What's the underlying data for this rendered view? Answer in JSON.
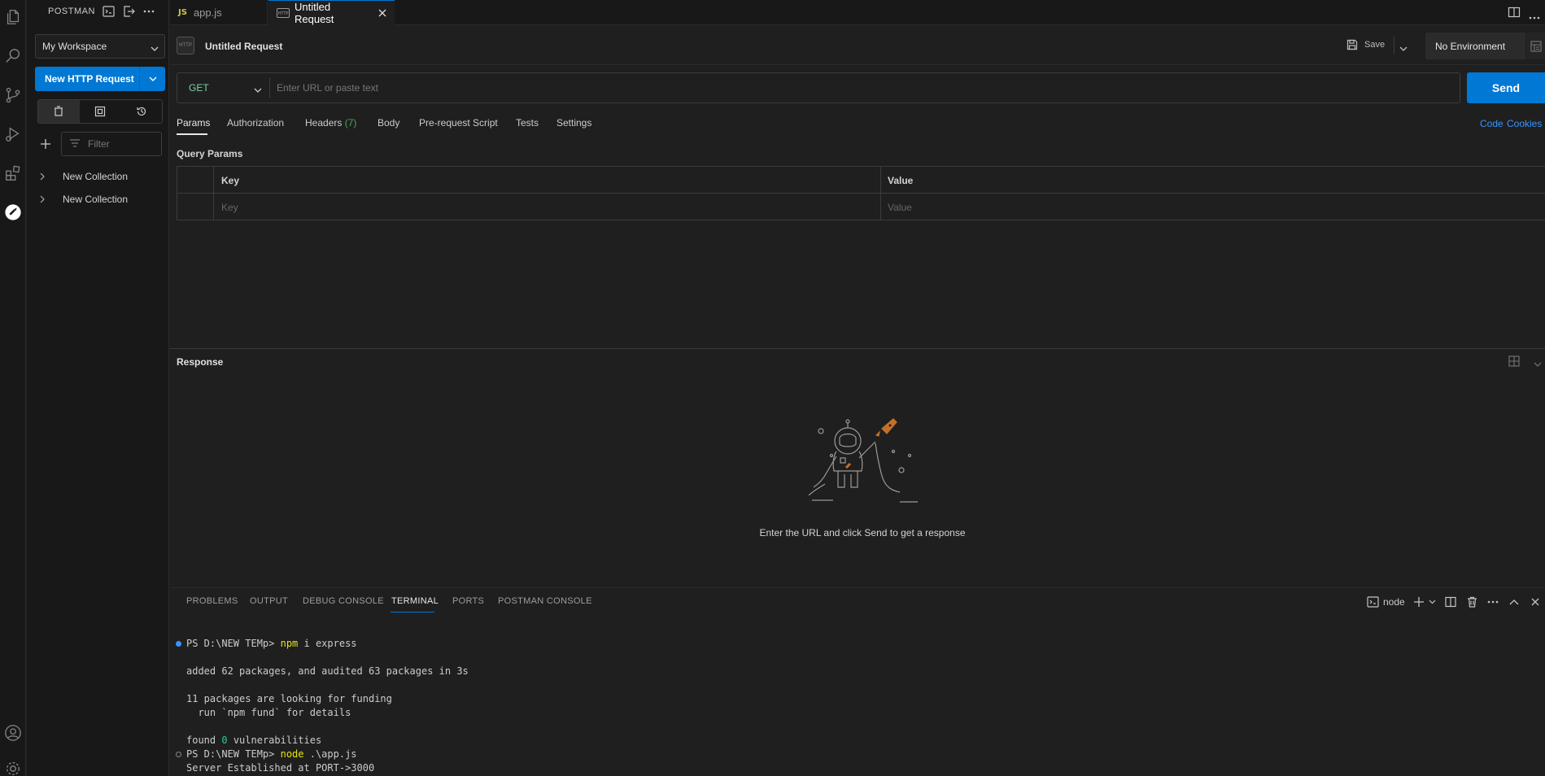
{
  "sidebar": {
    "title": "POSTMAN",
    "workspace": "My Workspace",
    "new_request": "New HTTP Request",
    "filter_placeholder": "Filter",
    "collections": [
      "New Collection",
      "New Collection"
    ]
  },
  "tabs": [
    {
      "badge": "JS",
      "label": "app.js"
    },
    {
      "badge": "HTTP",
      "label": "Untitled Request"
    }
  ],
  "request": {
    "title": "Untitled Request",
    "save_label": "Save",
    "environment": "No Environment",
    "method": "GET",
    "url_placeholder": "Enter URL or paste text",
    "send_label": "Send",
    "tabs": {
      "params": "Params",
      "authorization": "Authorization",
      "headers": "Headers",
      "headers_count": "(7)",
      "body": "Body",
      "prerequest": "Pre-request Script",
      "tests": "Tests",
      "settings": "Settings"
    },
    "links": {
      "code": "Code",
      "cookies": "Cookies"
    },
    "query_params_title": "Query Params",
    "table": {
      "key_header": "Key",
      "value_header": "Value",
      "key_placeholder": "Key",
      "value_placeholder": "Value"
    }
  },
  "response": {
    "title": "Response",
    "empty_message": "Enter the URL and click Send to get a response"
  },
  "panel": {
    "tabs": [
      "PROBLEMS",
      "OUTPUT",
      "DEBUG CONSOLE",
      "TERMINAL",
      "PORTS",
      "POSTMAN CONSOLE"
    ],
    "active_tab": "TERMINAL",
    "shell_label": "node"
  },
  "terminal": {
    "prompt1": "PS D:\\NEW TEMp> ",
    "cmd1_name": "npm",
    "cmd1_args": " i express",
    "line_added": "added 62 packages, and audited 63 packages in 3s",
    "line_funding": "11 packages are looking for funding",
    "line_fund_detail": "  run `npm fund` for details",
    "line_found_pre": "found ",
    "line_found_num": "0",
    "line_found_post": " vulnerabilities",
    "prompt2": "PS D:\\NEW TEMp> ",
    "cmd2_name": "node",
    "cmd2_args": " .\\app.js",
    "line_server": "Server Established at PORT->3000"
  },
  "colors": {
    "accent": "#0078d4",
    "method_get": "#7ed3a0",
    "link": "#3794ff"
  }
}
